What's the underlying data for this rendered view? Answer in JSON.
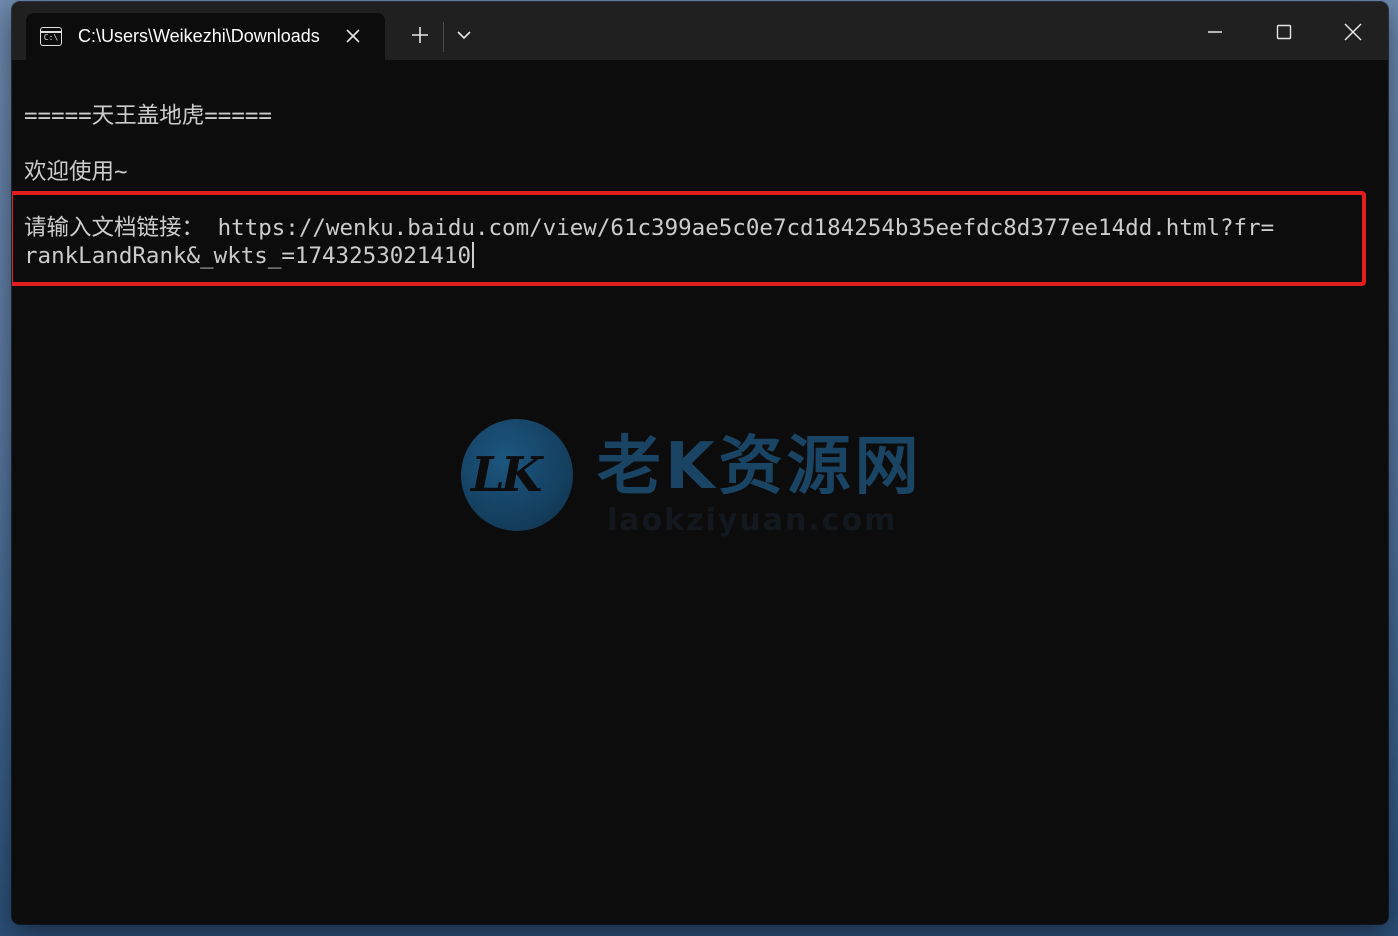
{
  "window": {
    "tab_title": "C:\\Users\\Weikezhi\\Downloads",
    "tab_icon_label": "C:\\"
  },
  "terminal": {
    "line1": "=====天王盖地虎=====",
    "line2": "欢迎使用~",
    "prompt": "请输入文档链接：",
    "input_line1": "https://wenku.baidu.com/view/61c399ae5c0e7cd184254b35eefdc8d377ee14dd.html?fr=",
    "input_line2": "rankLandRank&_wkts_=1743253021410"
  },
  "watermark": {
    "logo_letters": "LK",
    "text": "老K资源网",
    "subtext": "laokziyuan.com"
  },
  "colors": {
    "highlight_border": "#e11d1d",
    "terminal_bg": "#0c0c0c",
    "titlebar_bg": "#202020"
  }
}
